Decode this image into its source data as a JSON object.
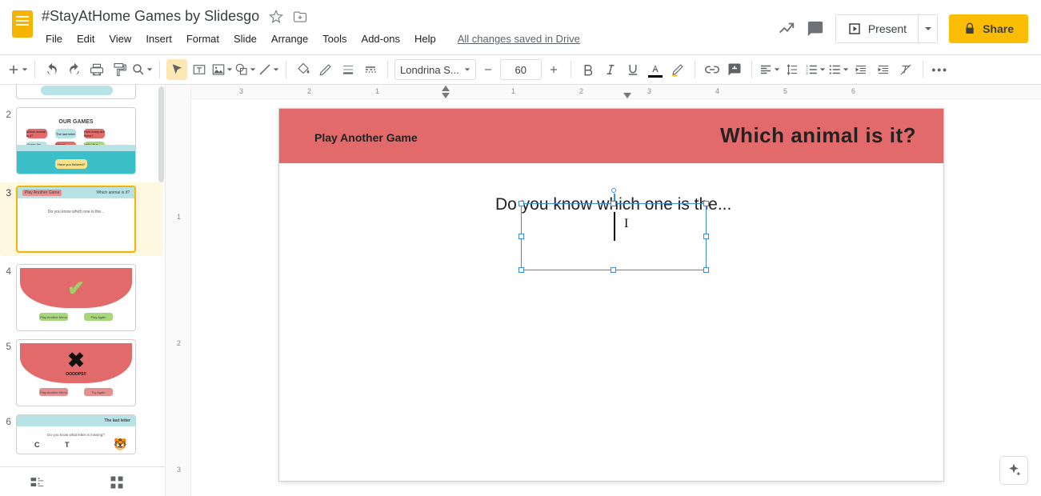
{
  "doc": {
    "title": "#StayAtHome Games by Slidesgo"
  },
  "menu": {
    "file": "File",
    "edit": "Edit",
    "view": "View",
    "insert": "Insert",
    "format": "Format",
    "slide": "Slide",
    "arrange": "Arrange",
    "tools": "Tools",
    "addons": "Add-ons",
    "help": "Help",
    "status": "All changes saved in Drive"
  },
  "header_buttons": {
    "present": "Present",
    "share": "Share"
  },
  "toolbar": {
    "font": "Londrina S...",
    "font_size": "60"
  },
  "ruler": {
    "h": {
      "n3": "3",
      "n2": "2",
      "n1": "1",
      "p1": "1",
      "p2": "2",
      "p3": "3",
      "p4": "4",
      "p5": "5",
      "p6": "6"
    },
    "v": {
      "p1": "1",
      "p2": "2",
      "p3": "3"
    }
  },
  "canvas": {
    "header_left": "Play Another Game",
    "header_right": "Which animal is it?",
    "body_text": "Do you know which one is the..."
  },
  "thumbs": {
    "s1": {
      "title": "OUR GAMES",
      "c1": "Which animal is it?",
      "c2": "The last letter",
      "c3": "How many are there?",
      "c4": "Guess the color",
      "c5": "Whose shadow is it?",
      "c6": "Let's do a puzzle!",
      "c7": "Have you finished?"
    },
    "s2": {
      "left": "Play Another Game",
      "right": "Which animal is it?",
      "sub": "Do you know which one is the..."
    },
    "s3": {
      "b1": "Play Another Menu",
      "b2": "Play Again"
    },
    "s4": {
      "oops": "OOOOPS!!",
      "b1": "Play Another Menu",
      "b2": "Try Again"
    },
    "s5": {
      "title": "The last letter",
      "sub": "Do you know what letter is missing?",
      "l1": "C",
      "l2": "T",
      "cat": "🐯"
    },
    "nums": {
      "n2": "2",
      "n3": "3",
      "n4": "4",
      "n5": "5",
      "n6": "6"
    }
  }
}
